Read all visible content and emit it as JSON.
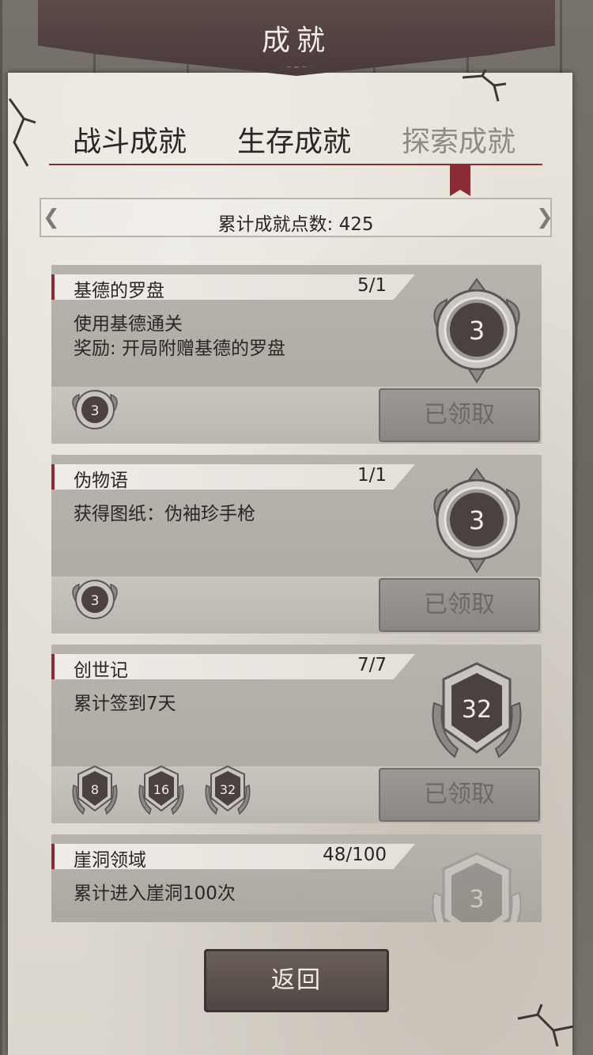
{
  "title": "成就",
  "tabs": [
    {
      "label": "战斗成就",
      "active": false
    },
    {
      "label": "生存成就",
      "active": false
    },
    {
      "label": "探索成就",
      "active": true
    }
  ],
  "total_points": {
    "label": "累计成就点数",
    "value": "425",
    "text": "累计成就点数: 425"
  },
  "achievements": [
    {
      "name": "基德的罗盘",
      "progress": "5/1",
      "desc_lines": [
        "使用基德通关",
        "奖励: 开局附赠基德的罗盘"
      ],
      "medal_value": "3",
      "medal_shape": "round",
      "small_medals": [
        "3"
      ],
      "button": "已领取"
    },
    {
      "name": "伪物语",
      "progress": "1/1",
      "desc_lines": [
        "获得图纸：伪袖珍手枪"
      ],
      "medal_value": "3",
      "medal_shape": "round",
      "small_medals": [
        "3"
      ],
      "button": "已领取"
    },
    {
      "name": "创世记",
      "progress": "7/7",
      "desc_lines": [
        "累计签到7天"
      ],
      "medal_value": "32",
      "medal_shape": "shield",
      "small_medals": [
        "8",
        "16",
        "32"
      ],
      "button": "已领取"
    },
    {
      "name": "崖洞领域",
      "progress": "48/100",
      "desc_lines": [
        "累计进入崖洞100次"
      ],
      "medal_value": "3",
      "medal_shape": "shield-faded",
      "small_medals": [],
      "button": ""
    }
  ],
  "back_button": "返回"
}
